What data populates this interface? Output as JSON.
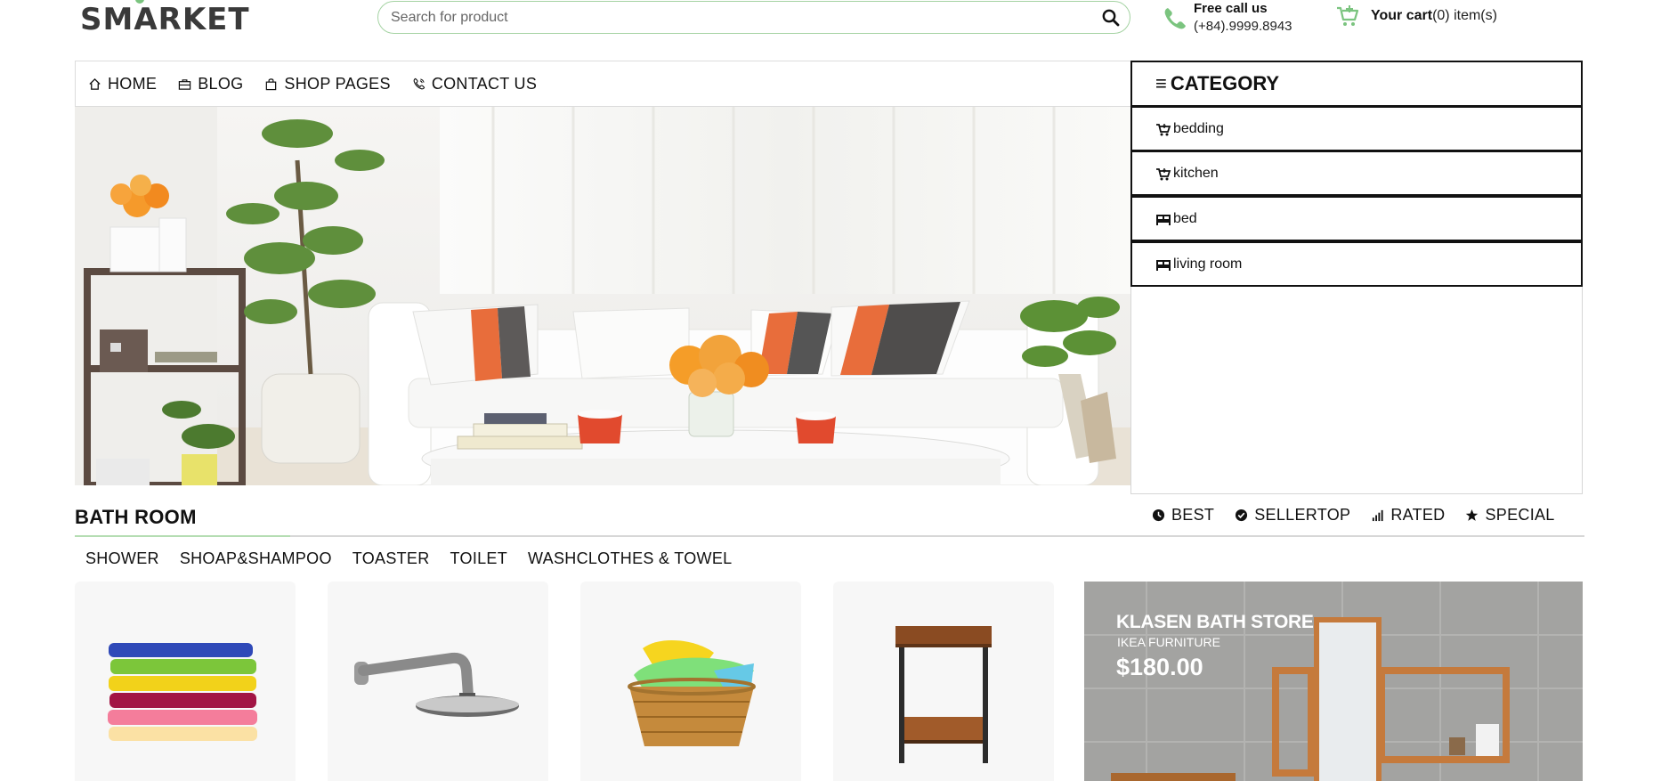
{
  "header": {
    "logo": "SMARKET",
    "search_placeholder": "Search for product",
    "call_title": "Free call us",
    "call_number": "(+84).9999.8943",
    "cart_label": "Your cart",
    "cart_count": "(0) item(s)"
  },
  "nav": {
    "items": [
      {
        "label": "HOME",
        "icon": "home-icon"
      },
      {
        "label": "BLOG",
        "icon": "briefcase-icon"
      },
      {
        "label": "SHOP PAGES",
        "icon": "bag-icon"
      },
      {
        "label": "CONTACT US",
        "icon": "phone-icon"
      }
    ]
  },
  "category": {
    "title": "CATEGORY",
    "items": [
      {
        "label": "bedding",
        "icon": "cart-plus-icon"
      },
      {
        "label": "kitchen",
        "icon": "cart-plus-icon"
      },
      {
        "label": "bed",
        "icon": "bed-icon"
      },
      {
        "label": "living room",
        "icon": "bed-icon"
      }
    ]
  },
  "section": {
    "title": "BATH ROOM",
    "filters": [
      {
        "label": "BEST",
        "icon": "clock-icon"
      },
      {
        "label": "SELLERTOP",
        "icon": "check-circle-icon"
      },
      {
        "label": "RATED",
        "icon": "signal-icon"
      },
      {
        "label": "SPECIAL",
        "icon": "star-icon"
      }
    ],
    "subtabs": [
      "SHOWER",
      "SHOAP&SHAMPOO",
      "TOASTER",
      "TOILET",
      "WASHCLOTHES & TOWEL"
    ]
  },
  "banner": {
    "title": "KLASEN BATH STORE",
    "subtitle": "IKEA FURNITURE",
    "price": "$180.00"
  },
  "colors": {
    "accent": "#7bc47f",
    "text": "#111111",
    "border": "#111111"
  }
}
